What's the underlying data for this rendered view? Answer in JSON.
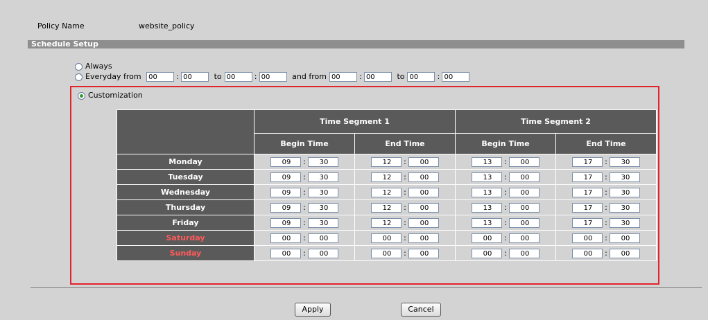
{
  "policy": {
    "label": "Policy Name",
    "value": "website_policy"
  },
  "section_title": "Schedule Setup",
  "options": {
    "always": {
      "label": "Always",
      "selected": false
    },
    "everyday": {
      "label_prefix": "Everyday from",
      "to1": "to",
      "and_from": "and from",
      "to2": "to",
      "times": [
        "00",
        "00",
        "00",
        "00",
        "00",
        "00",
        "00",
        "00"
      ],
      "selected": false
    },
    "customization": {
      "label": "Customization",
      "selected": true
    }
  },
  "table": {
    "segment1": "Time Segment 1",
    "segment2": "Time Segment 2",
    "begin": "Begin Time",
    "end": "End Time",
    "rows": [
      {
        "day": "Monday",
        "weekend": false,
        "t": [
          "09",
          "30",
          "12",
          "00",
          "13",
          "00",
          "17",
          "30"
        ]
      },
      {
        "day": "Tuesday",
        "weekend": false,
        "t": [
          "09",
          "30",
          "12",
          "00",
          "13",
          "00",
          "17",
          "30"
        ]
      },
      {
        "day": "Wednesday",
        "weekend": false,
        "t": [
          "09",
          "30",
          "12",
          "00",
          "13",
          "00",
          "17",
          "30"
        ]
      },
      {
        "day": "Thursday",
        "weekend": false,
        "t": [
          "09",
          "30",
          "12",
          "00",
          "13",
          "00",
          "17",
          "30"
        ]
      },
      {
        "day": "Friday",
        "weekend": false,
        "t": [
          "09",
          "30",
          "12",
          "00",
          "13",
          "00",
          "17",
          "30"
        ]
      },
      {
        "day": "Saturday",
        "weekend": true,
        "t": [
          "00",
          "00",
          "00",
          "00",
          "00",
          "00",
          "00",
          "00"
        ]
      },
      {
        "day": "Sunday",
        "weekend": true,
        "t": [
          "00",
          "00",
          "00",
          "00",
          "00",
          "00",
          "00",
          "00"
        ]
      }
    ]
  },
  "buttons": {
    "apply": "Apply",
    "cancel": "Cancel"
  },
  "colors": {
    "panel": "#d3d3d3",
    "header": "#5a5a5a",
    "highlight": "#e3232b",
    "weekend": "#ff5a5a"
  }
}
